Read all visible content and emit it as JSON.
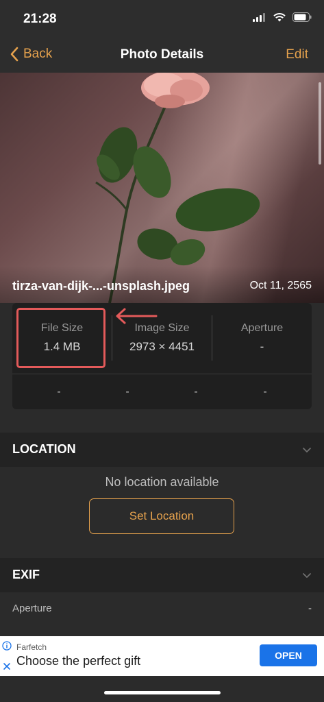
{
  "status_bar": {
    "time": "21:28"
  },
  "nav": {
    "back_label": "Back",
    "title": "Photo Details",
    "edit_label": "Edit"
  },
  "photo": {
    "filename": "tirza-van-dijk-...-unsplash.jpeg",
    "date": "Oct 11, 2565"
  },
  "details": {
    "file_size_label": "File Size",
    "file_size_value": "1.4 MB",
    "image_size_label": "Image Size",
    "image_size_value": "2973 × 4451",
    "aperture_label": "Aperture",
    "aperture_value": "-",
    "row2": [
      "-",
      "-",
      "-",
      "-"
    ]
  },
  "location": {
    "title": "LOCATION",
    "empty_text": "No location available",
    "button_label": "Set Location"
  },
  "exif": {
    "title": "EXIF",
    "rows": [
      {
        "label": "Aperture",
        "value": "-"
      }
    ]
  },
  "ad": {
    "brand": "Farfetch",
    "headline": "Choose the perfect gift",
    "cta": "OPEN"
  },
  "colors": {
    "accent": "#e6a24d",
    "highlight": "#e35a5a",
    "ad_button": "#1a73e8"
  }
}
